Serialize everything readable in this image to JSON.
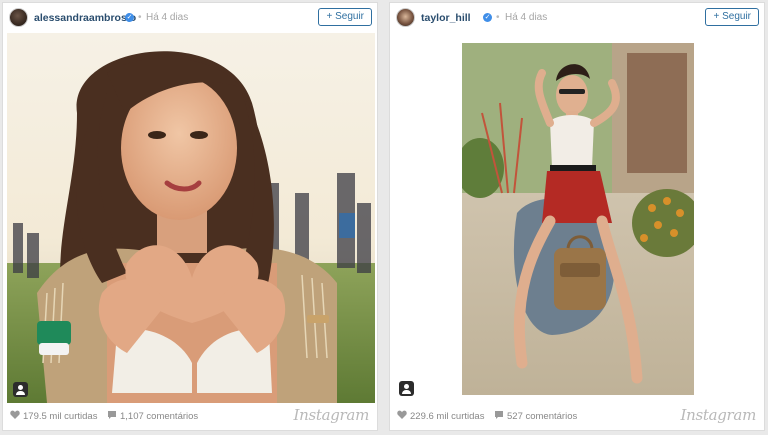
{
  "posts": [
    {
      "username": "alessandraambrosio",
      "separator": "•",
      "time": "Há 4 dias",
      "follow_label": "+ Seguir",
      "likes": "179.5 mil curtidas",
      "comments": "1,107 comentários",
      "brand": "Instagram"
    },
    {
      "username": "taylor_hill",
      "separator": "•",
      "time": "Há 4 dias",
      "follow_label": "+ Seguir",
      "likes": "229.6 mil curtidas",
      "comments": "527 comentários",
      "brand": "Instagram"
    }
  ],
  "colors": {
    "link": "#2a4d6e",
    "follow": "#2f6fa0",
    "verified": "#3f8ee8",
    "muted": "#888888"
  },
  "icons": [
    "verified-icon",
    "user-tag-icon",
    "heart-icon",
    "comment-icon"
  ]
}
